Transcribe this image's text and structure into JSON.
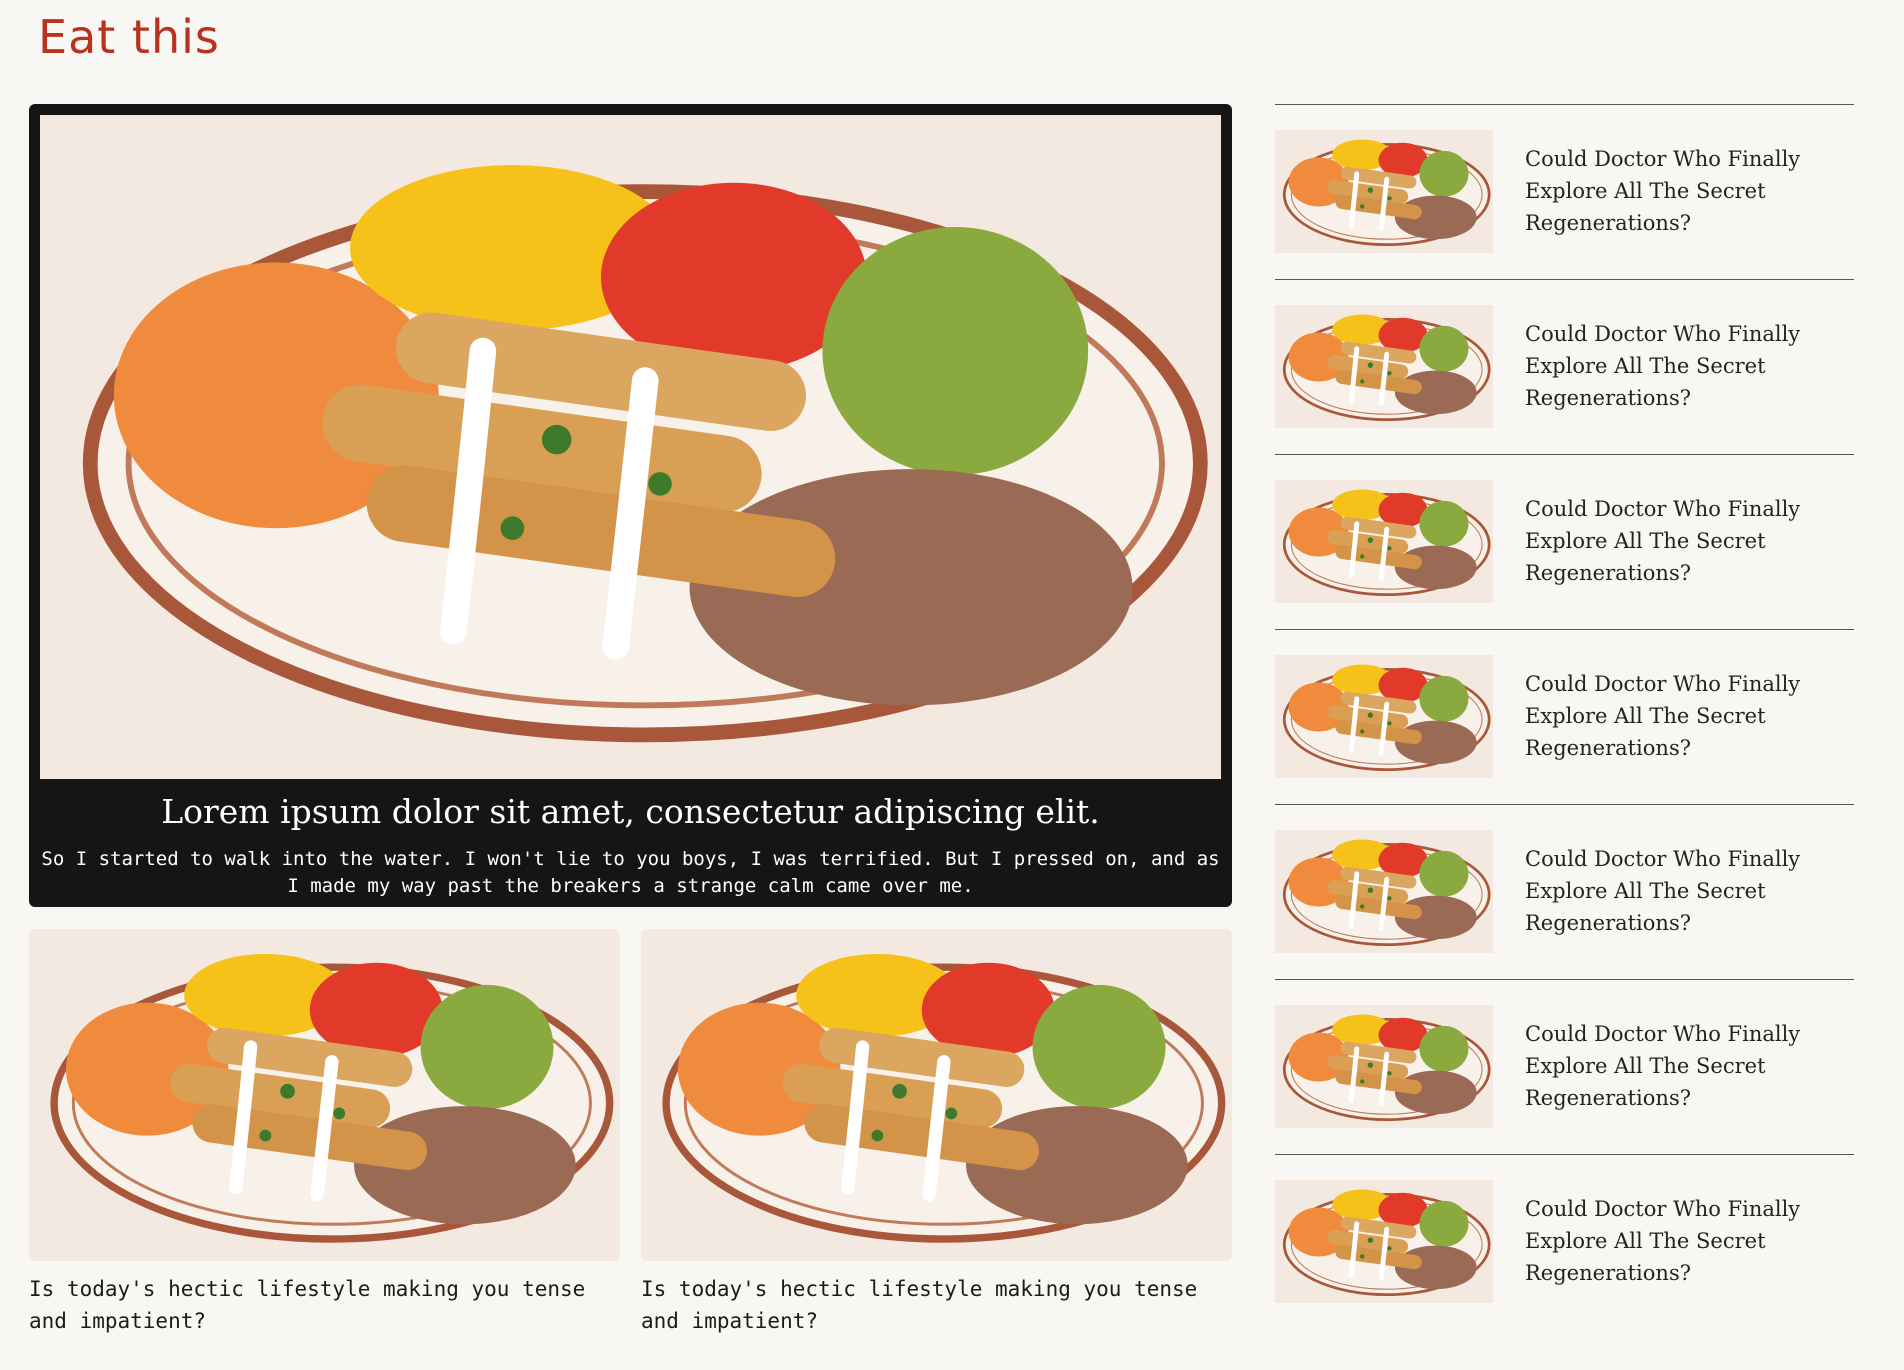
{
  "header": {
    "brand": "Eat this"
  },
  "featured": {
    "title": "Lorem ipsum dolor sit amet, consectetur adipiscing elit.",
    "text": "So I started to walk into the water. I won't lie to you boys, I was terrified. But I pressed on, and as I made my way past the breakers a strange calm came over me."
  },
  "cards": [
    {
      "caption": "Is today's hectic lifestyle making you tense and impatient?"
    },
    {
      "caption": "Is today's hectic lifestyle making you tense and impatient?"
    }
  ],
  "sidebar": {
    "items": [
      {
        "label": "Could Doctor Who Finally Explore All The Secret Regenerations?"
      },
      {
        "label": "Could Doctor Who Finally Explore All The Secret Regenerations?"
      },
      {
        "label": "Could Doctor Who Finally Explore All The Secret Regenerations?"
      },
      {
        "label": "Could Doctor Who Finally Explore All The Secret Regenerations?"
      },
      {
        "label": "Could Doctor Who Finally Explore All The Secret Regenerations?"
      },
      {
        "label": "Could Doctor Who Finally Explore All The Secret Regenerations?"
      },
      {
        "label": "Could Doctor Who Finally Explore All The Secret Regenerations?"
      }
    ]
  },
  "colors": {
    "brand": "#b8321f",
    "background": "#f9f7f4",
    "card": "#151515"
  }
}
